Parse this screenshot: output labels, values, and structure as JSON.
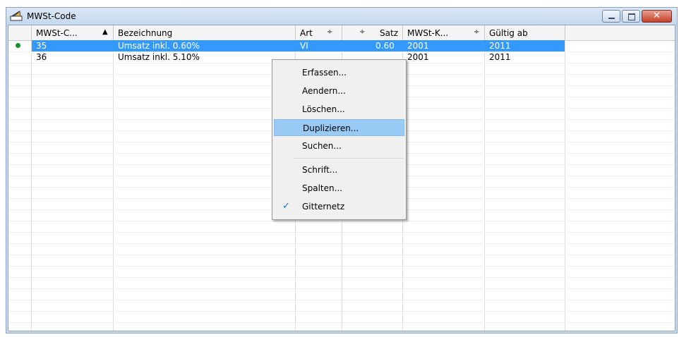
{
  "window": {
    "title": "MWSt-Code"
  },
  "columns": [
    {
      "label": "MWSt-C...",
      "sort": "▲"
    },
    {
      "label": "Bezeichnung",
      "sort": ""
    },
    {
      "label": "Art",
      "sort": "÷"
    },
    {
      "label": "Satz",
      "sort": "÷"
    },
    {
      "label": "MWSt-K...",
      "sort": "÷"
    },
    {
      "label": "Gültig ab",
      "sort": ""
    }
  ],
  "rows": [
    {
      "code": "35",
      "bezeichnung": "Umsatz inkl. 0.60%",
      "art": "VI",
      "satz": "0.60",
      "konto": "2001",
      "gueltig": "2011",
      "selected": true
    },
    {
      "code": "36",
      "bezeichnung": "Umsatz inkl. 5.10%",
      "art": "",
      "satz": "",
      "konto": "2001",
      "gueltig": "2011",
      "selected": false
    }
  ],
  "context_menu": {
    "items": [
      {
        "label": "Erfassen..."
      },
      {
        "label": "Aendern..."
      },
      {
        "label": "Löschen..."
      },
      {
        "label": "Duplizieren..."
      },
      {
        "label": "Suchen..."
      },
      {
        "label": "Schrift..."
      },
      {
        "label": "Spalten..."
      },
      {
        "label": "Gitternetz"
      }
    ],
    "highlighted": "Duplizieren...",
    "checked": "Gitternetz"
  },
  "colors": {
    "selection": "#3399ff",
    "menu_hover": "#99c9f5",
    "row_indicator": "#1a8f2e"
  }
}
